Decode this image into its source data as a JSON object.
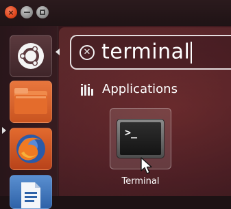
{
  "window_controls": {
    "close_glyph": "×",
    "minimize_icon": "minimize-icon",
    "maximize_icon": "maximize-icon"
  },
  "launcher": {
    "items": [
      {
        "name": "ubuntu-logo-icon",
        "tooltip": ""
      },
      {
        "name": "home-folder-icon",
        "tooltip": ""
      },
      {
        "name": "firefox-icon",
        "tooltip": ""
      },
      {
        "name": "libreoffice-writer-icon",
        "tooltip": ""
      }
    ]
  },
  "search": {
    "query": "terminal",
    "clear_icon": "⊗"
  },
  "results": {
    "category_label": "Applications",
    "category_icon": "applications-icon",
    "apps": [
      {
        "label": "Terminal",
        "icon": "terminal-icon",
        "prompt": ">_"
      }
    ]
  },
  "colors": {
    "accent": "#e0481e",
    "dash_bg": "#4a1c22",
    "text": "#ffffff"
  }
}
